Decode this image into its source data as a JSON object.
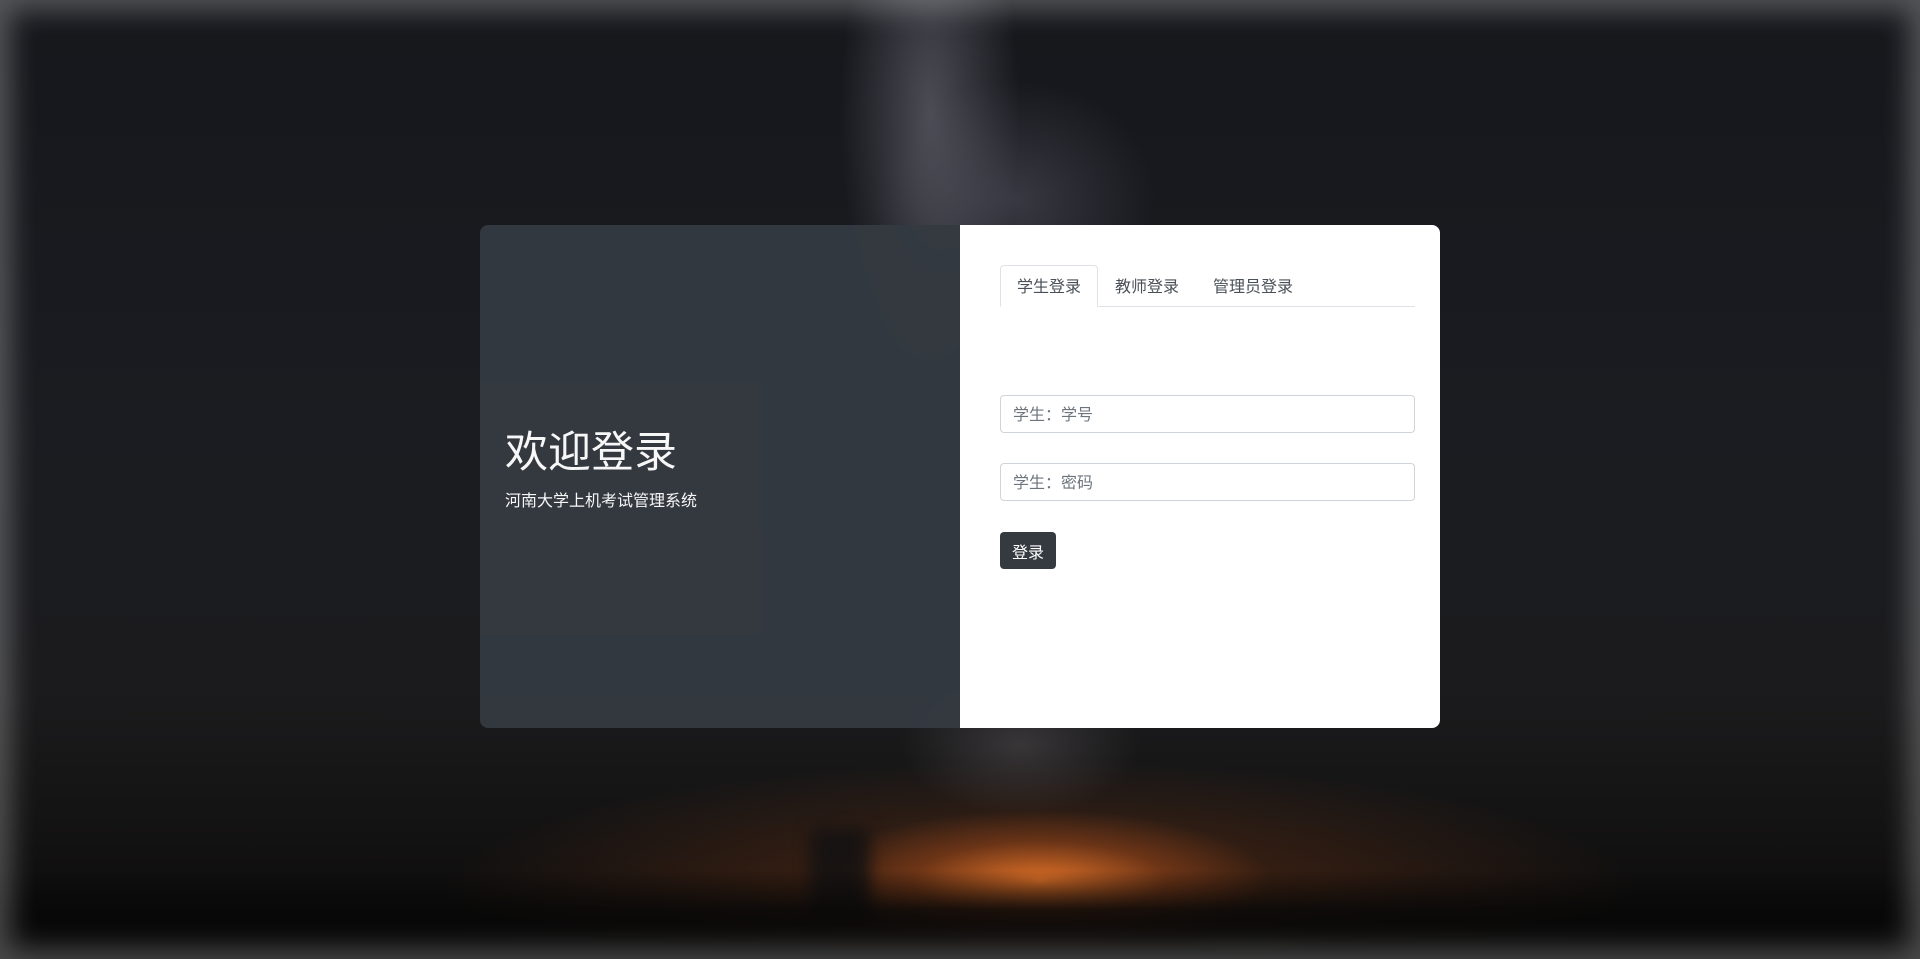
{
  "welcome": {
    "title": "欢迎登录",
    "subtitle": "河南大学上机考试管理系统"
  },
  "tabs": [
    {
      "label": "学生登录",
      "active": true
    },
    {
      "label": "教师登录",
      "active": false
    },
    {
      "label": "管理员登录",
      "active": false
    }
  ],
  "form": {
    "id_placeholder": "学生：学号",
    "id_value": "",
    "password_placeholder": "学生：密码",
    "password_value": "",
    "submit_label": "登录"
  },
  "colors": {
    "panel_dark": "#343a40",
    "button": "#343a40",
    "card_right": "#ffffff"
  }
}
